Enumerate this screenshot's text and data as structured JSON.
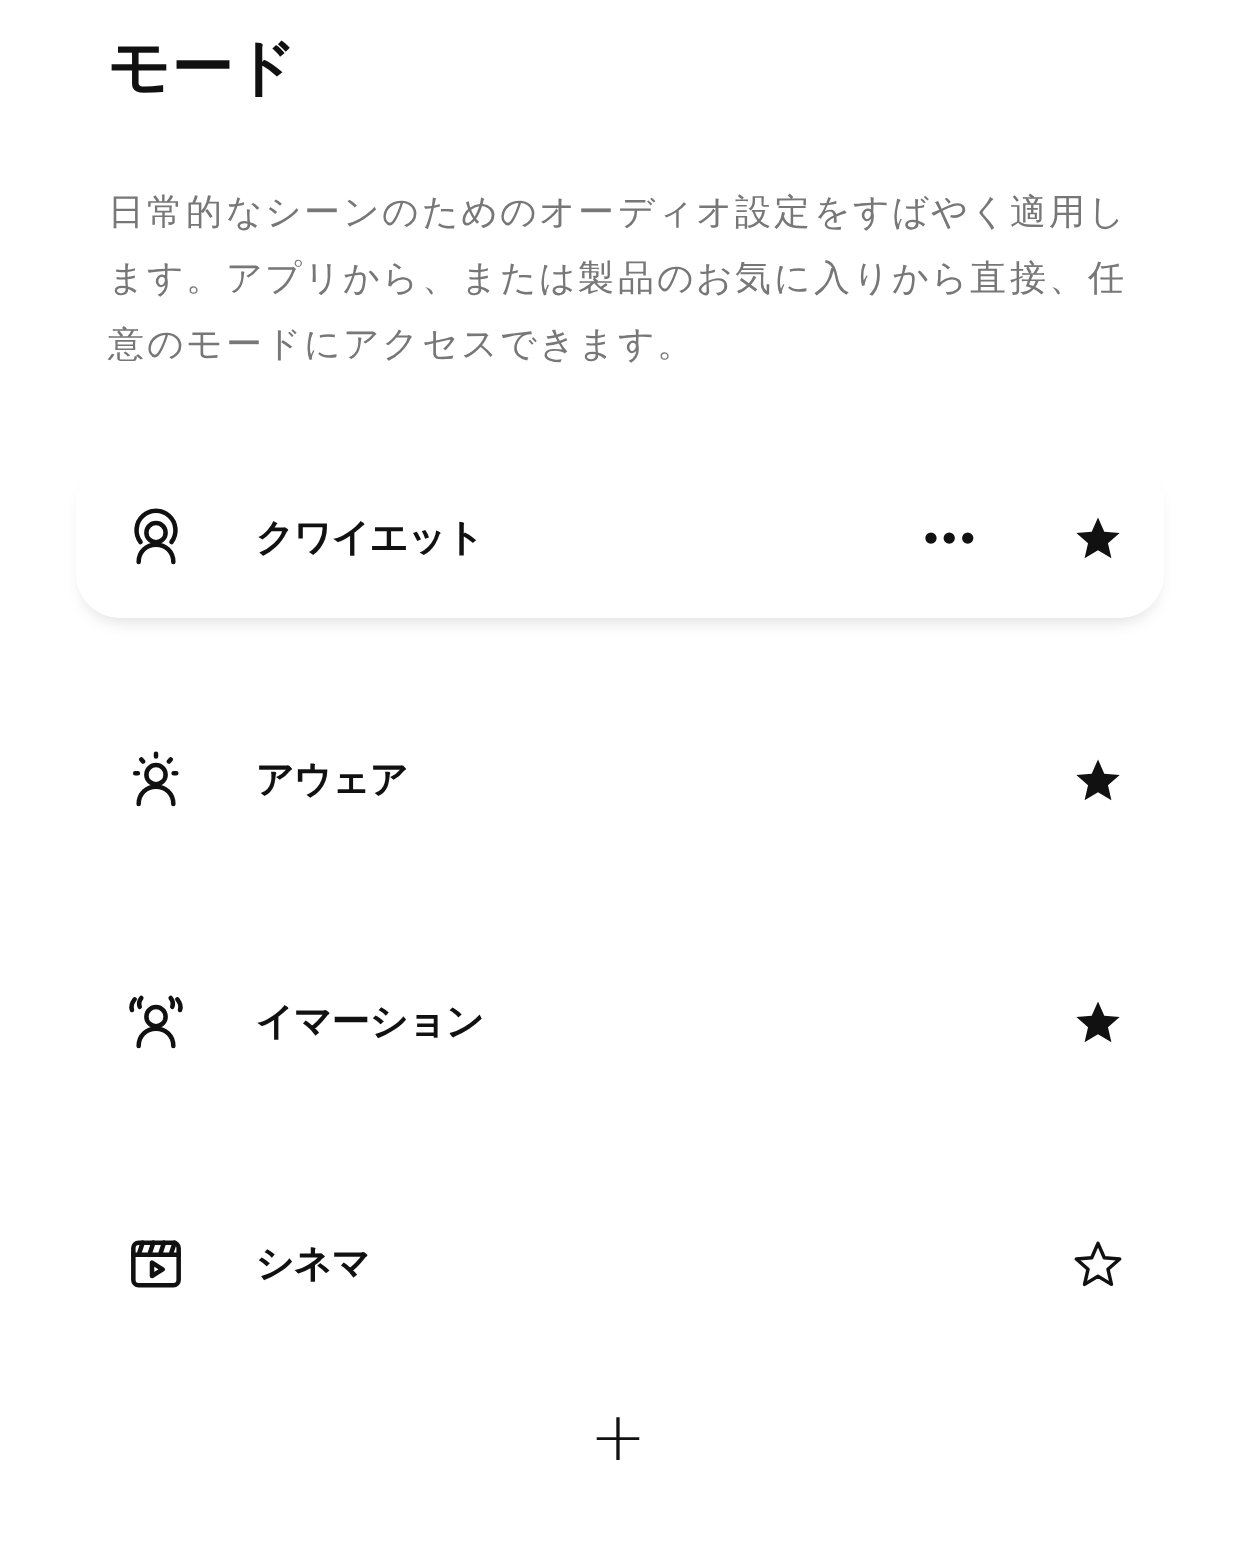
{
  "title": "モード",
  "description": "日常的なシーンのためのオーディオ設定をすばやく適用します。アプリから、または製品のお気に入りから直接、任意のモードにアクセスできます。",
  "modes": [
    {
      "kind": "quiet",
      "name": "クワイエット",
      "selected": true,
      "more": "•••",
      "favorite": true
    },
    {
      "kind": "aware",
      "name": "アウェア",
      "selected": false,
      "favorite": true
    },
    {
      "kind": "immersion",
      "name": "イマーション",
      "selected": false,
      "favorite": true
    },
    {
      "kind": "cinema",
      "name": "シネマ",
      "selected": false,
      "favorite": false
    }
  ],
  "add_button": "+"
}
